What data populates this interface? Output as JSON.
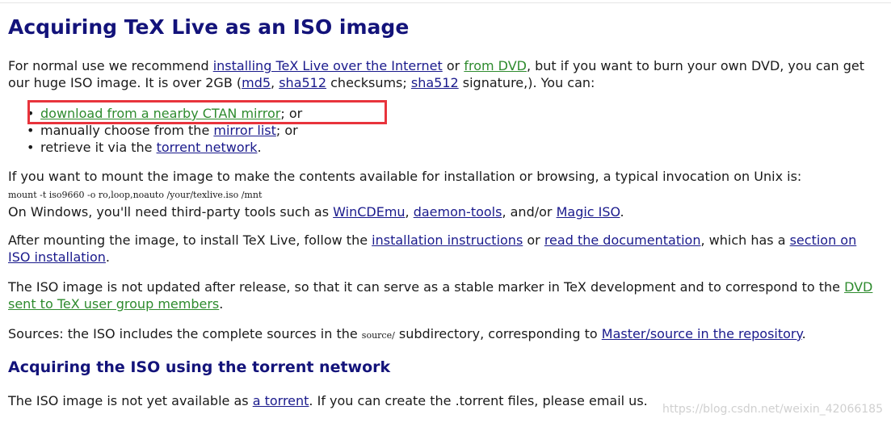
{
  "heading1": "Acquiring TeX Live as an ISO image",
  "intro": {
    "t1": "For normal use we recommend ",
    "link_internet": "installing TeX Live over the Internet",
    "t2": " or ",
    "link_dvd": "from DVD",
    "t3": ", but if you want to burn your own DVD, you can get",
    "t4": "our huge ISO image. It is over 2GB (",
    "link_md5": "md5",
    "t5": ", ",
    "link_sha512": "sha512",
    "t6": " checksums; ",
    "link_sha512_sig": "sha512",
    "t7": " signature,). You can:"
  },
  "options": {
    "bullet": "•",
    "item1_link": "download from a nearby CTAN mirror",
    "item1_tail": "; or",
    "item2_text": "manually choose from the ",
    "item2_link": "mirror list",
    "item2_tail": "; or",
    "item3_text": "retrieve it via the ",
    "item3_link": "torrent network",
    "item3_tail": "."
  },
  "mount": {
    "text": "If you want to mount the image to make the contents available for installation or browsing, a typical invocation on Unix is:",
    "command": "mount  -t  iso9660  -o  ro,loop,noauto  /your/texlive.iso  /mnt",
    "win_t1": "On Windows, you'll need third-party tools such as ",
    "win_link1": "WinCDEmu",
    "win_t2": ", ",
    "win_link2": "daemon-tools",
    "win_t3": ", and/or ",
    "win_link3": "Magic ISO",
    "win_t4": "."
  },
  "after": {
    "t1": "After mounting the image, to install TeX Live, follow the ",
    "link1": "installation instructions",
    "t2": " or ",
    "link2": "read the documentation",
    "t3": ", which has a ",
    "link3a": "section on",
    "link3b": "ISO installation",
    "t4": "."
  },
  "updated": {
    "t1": "The ISO image is not updated after release, so that it can serve as a stable marker in TeX development and to correspond to the ",
    "link_a": "DVD",
    "link_b": "sent to TeX user group members",
    "t2": "."
  },
  "sources": {
    "t1": "Sources: the ISO includes the complete sources in the ",
    "code": "source/",
    "t2": " subdirectory, corresponding to ",
    "link": "Master/source in the repository",
    "t3": "."
  },
  "heading2": "Acquiring the ISO using the torrent network",
  "torrent": {
    "t1": "The ISO image is not yet available as ",
    "link": "a torrent",
    "t2": ". If you can create the .torrent files, please email us."
  },
  "watermark": "https://blog.csdn.net/weixin_42066185",
  "colors": {
    "heading": "#13137a",
    "link": "#1a1a8c",
    "link_visited": "#2e8b2e",
    "highlight": "#e8343c"
  }
}
